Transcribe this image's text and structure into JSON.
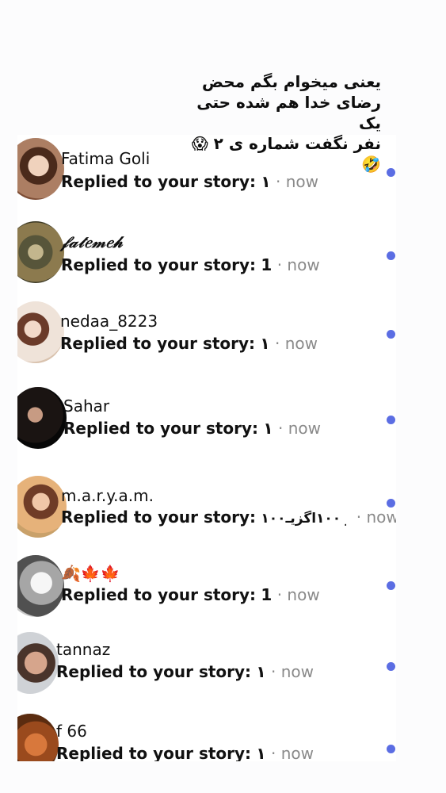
{
  "caption": "یعنی میخوام بگم محض\nرضای خدا هم شده حتی یک\nنفر نگفت شماره ی ۲ 😱🤣",
  "accent_color": "#5b6de3",
  "rows": [
    {
      "name": "Fatima Goli",
      "label": "Replied to your story:",
      "value": "۱",
      "sep": "·",
      "time": "now"
    },
    {
      "name": "𝒻𝒶𝓉𝑒𝓂𝑒𝒽",
      "label": "Replied to your story:",
      "value": "1",
      "sep": "·",
      "time": "now"
    },
    {
      "name": "nedaa_8223",
      "label": "Replied to your story:",
      "value": "۱",
      "sep": "·",
      "time": "now"
    },
    {
      "name": "Sahar",
      "label": "Replied to your story:",
      "value": "۱",
      "sep": "·",
      "time": "now"
    },
    {
      "name": "m.a.r.y.a.m.",
      "label": "Replied to your story:",
      "value": "۱۰۰در ۱۰۰اگزیـ...",
      "sep": "·",
      "time": "now"
    },
    {
      "name": "🍂🍁🍁",
      "label": "Replied to your story:",
      "value": "1",
      "sep": "·",
      "time": "now"
    },
    {
      "name": "tannaz",
      "label": "Replied to your story:",
      "value": "۱",
      "sep": "·",
      "time": "now"
    },
    {
      "name": "f 66",
      "label": "Replied to your story:",
      "value": "۱",
      "sep": "·",
      "time": "now"
    }
  ]
}
